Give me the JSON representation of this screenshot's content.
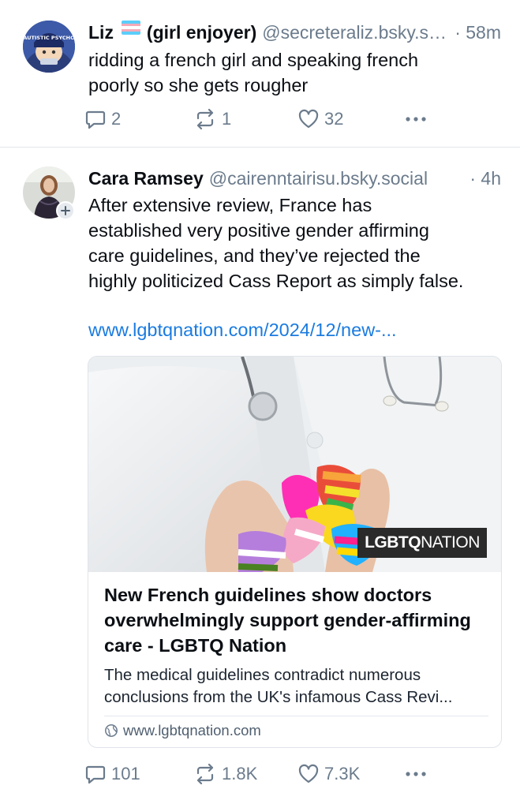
{
  "posts": [
    {
      "author_name": "Liz",
      "author_suffix": "(girl enjoyer)",
      "handle": "@secreteraliz.bsky.social",
      "time": "· 58m",
      "avatar_text": "AUTISTIC PSYCHO",
      "text_lines": [
        "ridding a french girl and speaking french",
        "poorly so she gets rougher"
      ],
      "replies": "2",
      "reposts": "1",
      "likes": "32"
    },
    {
      "author_name": "Cara Ramsey",
      "handle": "@cairenntairisu.bsky.social",
      "time": "· 4h",
      "text_lines": [
        "After extensive review, France has",
        "established very positive gender affirming",
        "care guidelines, and they’ve rejected the",
        "highly politicized Cass Report as simply false."
      ],
      "link": "www.lgbtqnation.com/2024/12/new-...",
      "card": {
        "logo_bold": "LGBTQ",
        "logo_rest": "NATION",
        "title_lines": [
          "New French guidelines show doctors",
          "overwhelmingly support gender-affirming",
          "care - LGBTQ Nation"
        ],
        "desc_lines": [
          "The medical guidelines contradict numerous",
          "conclusions from the UK's infamous Cass Revi..."
        ],
        "domain": "www.lgbtqnation.com"
      },
      "replies": "101",
      "reposts": "1.8K",
      "likes": "7.3K"
    }
  ],
  "colors": {
    "link": "#1a7be0",
    "muted": "#6b7b8c",
    "text": "#0b0f14"
  },
  "icons": [
    "reply-icon",
    "repost-icon",
    "like-icon",
    "more-icon",
    "globe-icon",
    "follow-plus-icon"
  ]
}
